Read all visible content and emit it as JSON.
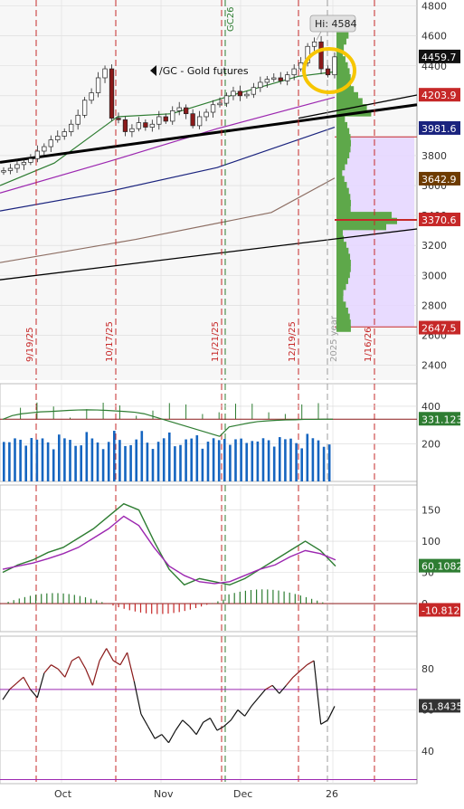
{
  "chart_data": [
    {
      "panel": "price",
      "type": "candlestick",
      "title": "/GC - Gold futures",
      "hi_label": "Hi: 4584",
      "y_ticks": [
        2400,
        2600,
        2800,
        3000,
        3200,
        3400,
        3600,
        3800,
        4000,
        4200,
        4400,
        4600,
        4800
      ],
      "ylim": [
        2300,
        4840
      ],
      "price_badges": [
        {
          "value": "4459.7",
          "color": "#111111"
        },
        {
          "value": "4203.9",
          "color": "#c62828"
        },
        {
          "value": "3981.6",
          "color": "#1a237e"
        },
        {
          "value": "3642.9",
          "color": "#6d3b00"
        },
        {
          "value": "3370.6",
          "color": "#c62828"
        },
        {
          "value": "2647.5",
          "color": "#c62828"
        }
      ],
      "event_lines": [
        "9/19/25",
        "10/17/25",
        "11/21/25",
        "12/19/25",
        "1/16/26"
      ],
      "side_labels": [
        "2025 year",
        "GC26"
      ],
      "closes": [
        3700,
        3715,
        3740,
        3755,
        3780,
        3830,
        3860,
        3905,
        3930,
        3960,
        4010,
        4070,
        4170,
        4220,
        4320,
        4380,
        4050,
        4040,
        3960,
        3980,
        4020,
        3990,
        4010,
        4060,
        4030,
        4100,
        4120,
        4080,
        4000,
        4060,
        4090,
        4140,
        4150,
        4200,
        4230,
        4200,
        4210,
        4255,
        4290,
        4310,
        4320,
        4300,
        4340,
        4380,
        4420,
        4530,
        4560,
        4380,
        4340,
        4460
      ]
    },
    {
      "panel": "volume",
      "type": "bar",
      "y_ticks": [
        200,
        400
      ],
      "ylim": [
        0,
        520
      ],
      "last_value": "331.123",
      "moving_average": [
        330,
        350,
        360,
        365,
        370,
        372,
        375,
        378,
        380,
        381,
        380,
        378,
        375,
        372,
        368,
        360,
        345,
        330,
        315,
        300,
        285,
        270,
        255,
        240,
        290,
        300,
        310,
        318,
        322,
        325,
        327,
        328,
        330,
        330,
        331,
        331
      ]
    },
    {
      "panel": "macd",
      "type": "line",
      "y_ticks": [
        50,
        100,
        150
      ],
      "ylim": [
        -45,
        190
      ],
      "macd_value": "60.1082",
      "histogram_value": "-10.812",
      "series": [
        {
          "color": "#2e7d32",
          "values": [
            50,
            62,
            70,
            82,
            90,
            105,
            120,
            140,
            160,
            150,
            100,
            55,
            30,
            40,
            35,
            30,
            40,
            55,
            70,
            85,
            100,
            85,
            60
          ]
        },
        {
          "color": "#9c27b0",
          "values": [
            55,
            60,
            65,
            72,
            80,
            90,
            105,
            120,
            140,
            125,
            90,
            60,
            45,
            35,
            32,
            35,
            45,
            55,
            62,
            75,
            85,
            80,
            70
          ]
        }
      ]
    },
    {
      "panel": "oscillator",
      "type": "line",
      "y_ticks": [
        40,
        60,
        80
      ],
      "ylim": [
        24,
        96
      ],
      "last_value": "61.8435",
      "values": [
        65,
        70,
        73,
        76,
        70,
        66,
        78,
        82,
        80,
        76,
        84,
        86,
        80,
        72,
        84,
        90,
        84,
        82,
        88,
        74,
        58,
        52,
        46,
        48,
        44,
        50,
        55,
        52,
        48,
        54,
        56,
        50,
        52,
        55,
        60,
        57,
        62,
        66,
        70,
        72,
        68,
        72,
        76,
        79,
        82,
        84,
        53,
        55,
        61.8
      ]
    }
  ],
  "x_axis": {
    "labels": [
      "Oct",
      "Nov",
      "Dec",
      "26"
    ]
  },
  "colors": {
    "up": "#ffffff",
    "down": "#8b1a1a",
    "grid": "#d8d8d8",
    "event": "#c62828",
    "highlight": "#f7c600"
  }
}
